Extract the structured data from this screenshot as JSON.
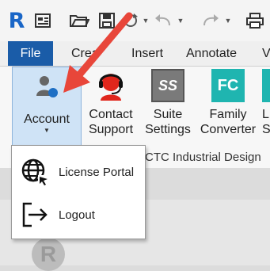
{
  "app": {
    "logo_letter": "R"
  },
  "tabs": [
    {
      "label": "File"
    },
    {
      "label": "Crea"
    },
    {
      "label": "Insert"
    },
    {
      "label": "Annotate"
    },
    {
      "label": "V"
    }
  ],
  "ribbon": {
    "buttons": [
      {
        "line1": "Account",
        "icon": "account-icon"
      },
      {
        "line1": "Contact",
        "line2": "Support",
        "icon": "support-headset-icon"
      },
      {
        "line1": "Suite",
        "line2": "Settings",
        "icon": "suite-settings-icon",
        "icon_text": "SS"
      },
      {
        "line1": "Family",
        "line2": "Converter",
        "icon": "family-converter-icon",
        "icon_text": "FC"
      },
      {
        "line1": "L",
        "line2": "S"
      }
    ],
    "panel_label": "CTC Industrial Design"
  },
  "account_menu": {
    "items": [
      {
        "label": "License Portal",
        "icon": "globe-cursor-icon"
      },
      {
        "label": "Logout",
        "icon": "logout-icon"
      }
    ]
  },
  "colors": {
    "file_tab": "#1a5ca8",
    "account_highlight": "#cfe3f6",
    "arrow": "#e8463a",
    "family_converter": "#1fb5b0",
    "suite_settings": "#7a7a7a"
  }
}
